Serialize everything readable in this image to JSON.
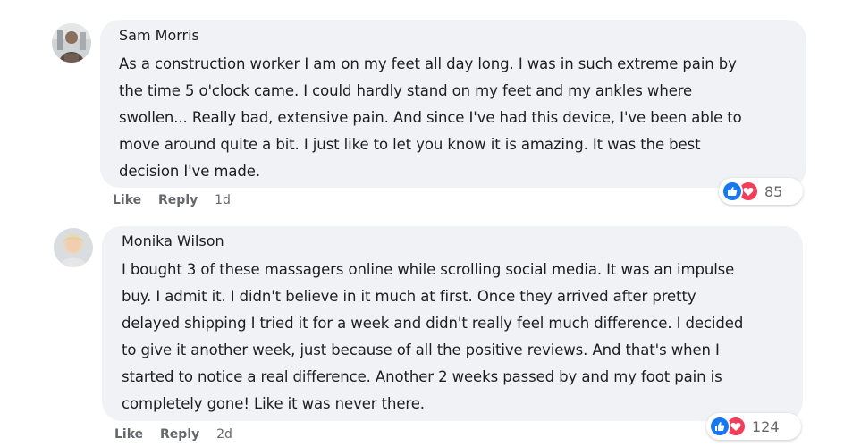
{
  "colors": {
    "bubble": "#f0f2f5",
    "like_blue": "#1877f2",
    "love_red": "#f33e58",
    "meta_text": "#65676b"
  },
  "comments": [
    {
      "author": "Sam Morris",
      "avatar_icon": "avatar-photo-icon",
      "lines": [
        "As a construction worker I am on my feet all day long. I was in such extreme pain by",
        "the time 5 o'clock came. I could hardly stand on my feet and my ankles where",
        "swollen... Really bad, extensive pain. And since I've had this device, I've been able to",
        "move around quite a bit. I just like to let you know it is amazing. It was the best",
        "decision I've made."
      ],
      "actions": {
        "like": "Like",
        "reply": "Reply",
        "time": "1d"
      },
      "reactions": {
        "count": "85",
        "types": [
          "like",
          "love"
        ]
      }
    },
    {
      "author": "Monika Wilson",
      "avatar_icon": "avatar-photo-icon",
      "lines": [
        "I bought 3 of these massagers online while scrolling social media. It was an impulse",
        "buy. I admit it. I didn't believe in it much at first. Once they arrived after pretty",
        "delayed shipping I tried it for a week and didn't really feel much difference. I decided",
        "to give it another week, just because of all the positive reviews. And that's when I",
        "started to notice a real difference. Another 2 weeks passed by and my foot pain is",
        "completely gone! Like it was never there."
      ],
      "actions": {
        "like": "Like",
        "reply": "Reply",
        "time": "2d"
      },
      "reactions": {
        "count": "124",
        "types": [
          "like",
          "love"
        ]
      }
    }
  ]
}
